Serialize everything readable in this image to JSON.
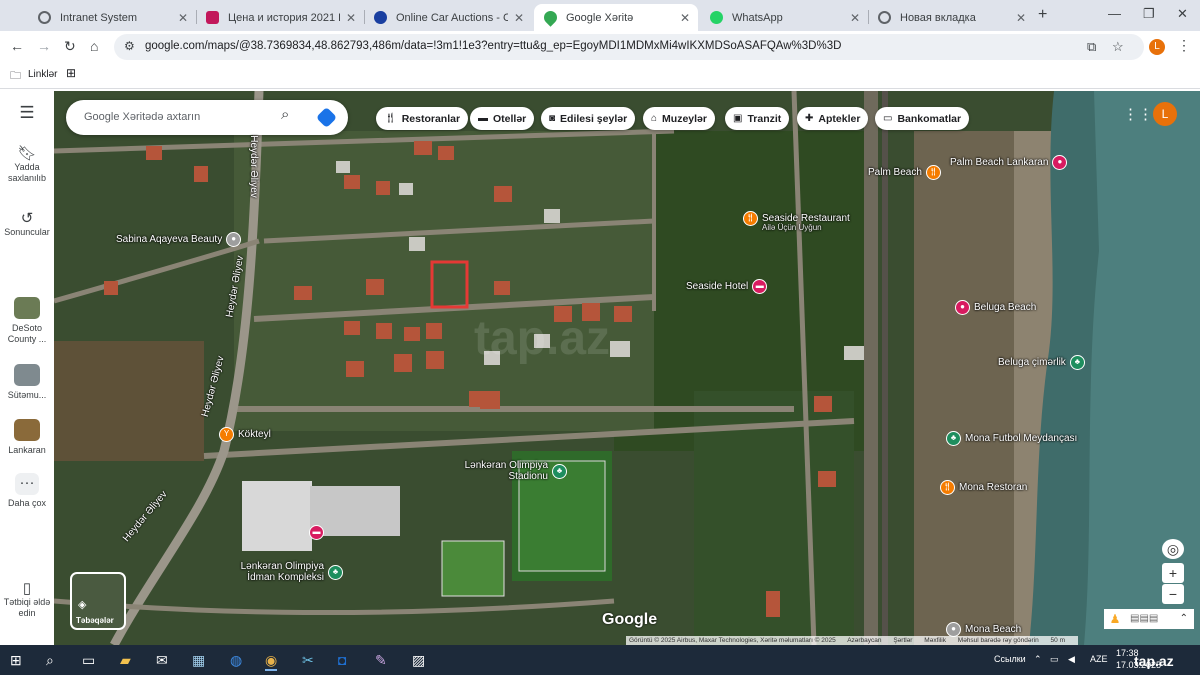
{
  "browser": {
    "tabs": [
      {
        "label": "Intranet System",
        "icon": "gear-icon",
        "color": "#5f6368"
      },
      {
        "label": "Цена и история 2021 Honda",
        "icon": "car-icon",
        "color": "#c2185b"
      },
      {
        "label": "Online Car Auctions - Copart",
        "icon": "copart-icon",
        "color": "#1a3fa0"
      },
      {
        "label": "Google Xəritə",
        "icon": "maps-pin-icon",
        "color": "#34a853",
        "active": true
      },
      {
        "label": "WhatsApp",
        "icon": "whatsapp-icon",
        "color": "#25d366"
      },
      {
        "label": "Новая вкладка",
        "icon": "chrome-icon",
        "color": "#5f6368"
      }
    ],
    "url": "google.com/maps/@38.7369834,48.862793,486m/data=!3m1!1e3?entry=ttu&g_ep=EgoyMDI1MDMxMi4wIKXMDSoASAFQAw%3D%3D",
    "profile_initial": "L",
    "bookmarks": {
      "links_label": "Linklər"
    }
  },
  "sidebar": {
    "items": [
      {
        "label": "Yadda saxlanılıb",
        "icon": "bookmark-icon"
      },
      {
        "label": "Sonuncular",
        "icon": "history-icon"
      },
      {
        "label": "DeSoto County ...",
        "icon": "place-thumb"
      },
      {
        "label": "Sütəmu...",
        "icon": "place-thumb"
      },
      {
        "label": "Lankaran",
        "icon": "place-thumb"
      },
      {
        "label": "Daha çox",
        "icon": "more-icon"
      },
      {
        "label": "Tətbiqi əldə edin",
        "icon": "phone-icon"
      }
    ]
  },
  "map": {
    "search_placeholder": "Google Xəritədə axtarın",
    "chips": [
      {
        "label": "Restoranlar",
        "icon": "restaurant-icon"
      },
      {
        "label": "Otellər",
        "icon": "hotel-icon"
      },
      {
        "label": "Edilesi şeylər",
        "icon": "camera-icon"
      },
      {
        "label": "Muzeylər",
        "icon": "museum-icon"
      },
      {
        "label": "Tranzit",
        "icon": "transit-icon"
      },
      {
        "label": "Aptekler",
        "icon": "pharmacy-icon"
      },
      {
        "label": "Bankomatlar",
        "icon": "atm-icon"
      }
    ],
    "avatar_initial": "L",
    "pois": [
      {
        "name": "Palm Beach Lankaran",
        "color": "#d81b60"
      },
      {
        "name": "Palm Beach",
        "color": "#f57c00"
      },
      {
        "name": "Seaside Restaurant",
        "sub": "Ailə Üçün Uyğun",
        "color": "#f57c00"
      },
      {
        "name": "Seaside Hotel",
        "color": "#d81b60"
      },
      {
        "name": "Beluga Beach",
        "color": "#d81b60"
      },
      {
        "name": "Beluga çimərlik",
        "color": "#1e8e5e"
      },
      {
        "name": "Mona Futbol Meydançası",
        "color": "#1e8e5e"
      },
      {
        "name": "Mona Restoran",
        "color": "#f57c00"
      },
      {
        "name": "Mona Beach",
        "color": "#9e9e9e"
      },
      {
        "name": "Sabina Aqayeva Beauty",
        "color": "#9e9e9e"
      },
      {
        "name": "Kökteyl",
        "color": "#f57c00"
      },
      {
        "name": "Lənkəran Olimpiya Stadionu",
        "color": "#1e8e5e"
      },
      {
        "name": "Lənkəran Olimpiya İdman Kompleksi",
        "color": "#1e8e5e"
      }
    ],
    "roads": [
      "Heydər Əliyev",
      "Heydər Əliyev",
      "Heydər Əliyev",
      "Heydər Əliyev"
    ],
    "layers_label": "Təbəqələr",
    "google_logo": "Google",
    "attribution": {
      "imagery": "Görüntü © 2025 Airbus, Maxar Technologies, Xəritə məlumatları © 2025",
      "country": "Azərbaycan",
      "terms": "Şərtlər",
      "privacy": "Məxfilik",
      "feedback": "Məhsul barədə rəy göndərin",
      "scale": "50 m"
    },
    "watermark": "tap.az"
  },
  "taskbar": {
    "links_label": "Ссылки",
    "language": "AZE",
    "time": "17:38",
    "date": "17.03.2025",
    "brand": "tap.az"
  }
}
